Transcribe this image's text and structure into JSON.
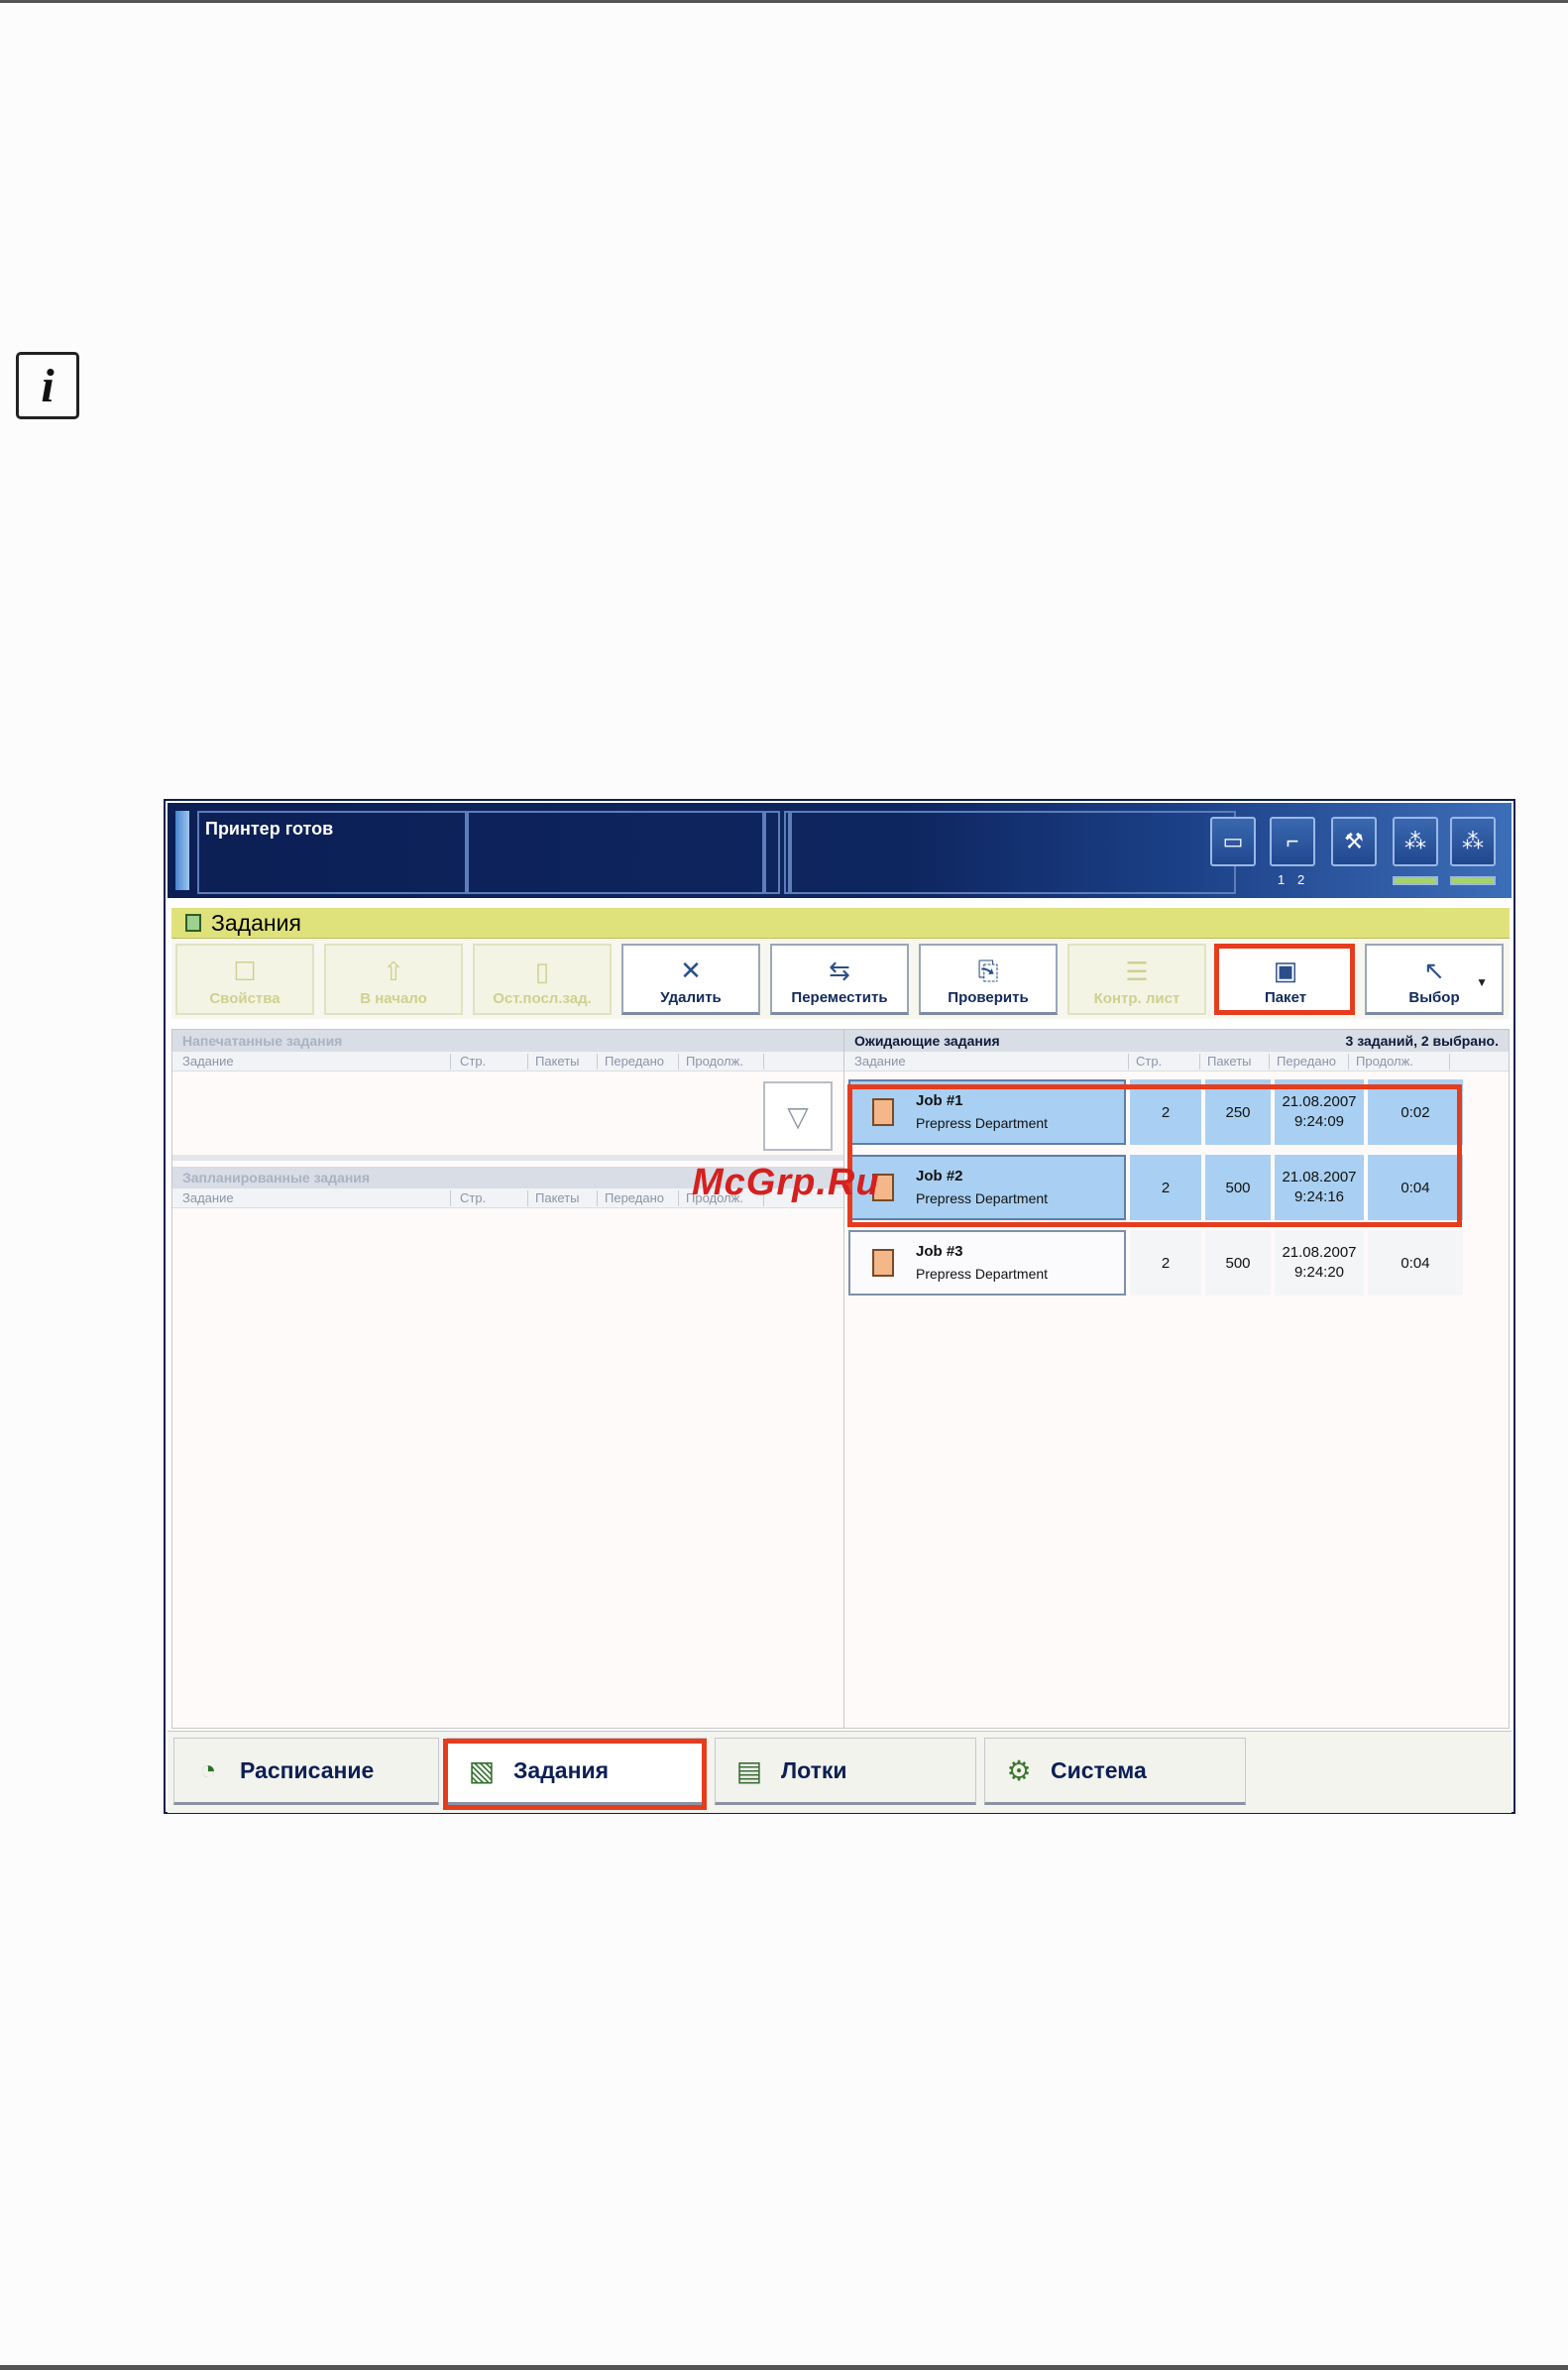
{
  "info_icon": {
    "glyph": "i"
  },
  "app": {
    "status": "Принтер готов",
    "header_numbers": [
      "1",
      "2"
    ],
    "title": "Задания",
    "toolbar": [
      {
        "label": "Свойства",
        "icon": "properties-icon",
        "glyph": "☐",
        "enabled": false
      },
      {
        "label": "В начало",
        "icon": "to-top-icon",
        "glyph": "⇧",
        "enabled": false
      },
      {
        "label": "Ост.посл.зад.",
        "icon": "stop-after-job-icon",
        "glyph": "▯",
        "enabled": false
      },
      {
        "label": "Удалить",
        "icon": "delete-icon",
        "glyph": "✕",
        "enabled": true
      },
      {
        "label": "Переместить",
        "icon": "move-icon",
        "glyph": "⇆",
        "enabled": true
      },
      {
        "label": "Проверить",
        "icon": "proof-icon",
        "glyph": "⎘",
        "enabled": true
      },
      {
        "label": "Контр. лист",
        "icon": "control-sheet-icon",
        "glyph": "☰",
        "enabled": false
      },
      {
        "label": "Пакет",
        "icon": "package-icon",
        "glyph": "▣",
        "enabled": true
      },
      {
        "label": "Выбор",
        "icon": "select-icon",
        "glyph": "↖",
        "enabled": true
      }
    ],
    "printed_jobs": {
      "title": "Напечатанные задания",
      "columns": [
        "Задание",
        "Стр.",
        "Пакеты",
        "Передано",
        "Продолж."
      ]
    },
    "scheduled_jobs": {
      "title": "Запланированные задания",
      "columns": [
        "Задание",
        "Стр.",
        "Пакеты",
        "Передано",
        "Продолж."
      ]
    },
    "waiting_jobs": {
      "title": "Ожидающие задания",
      "summary": "3 заданий, 2 выбрано.",
      "columns": [
        "Задание",
        "Стр.",
        "Пакеты",
        "Передано",
        "Продолж."
      ],
      "rows": [
        {
          "name": "Job #1",
          "dept": "Prepress Department",
          "pages": "2",
          "sets": "250",
          "date": "21.08.2007",
          "time": "9:24:09",
          "duration": "0:02",
          "selected": true
        },
        {
          "name": "Job #2",
          "dept": "Prepress Department",
          "pages": "2",
          "sets": "500",
          "date": "21.08.2007",
          "time": "9:24:16",
          "duration": "0:04",
          "selected": true
        },
        {
          "name": "Job #3",
          "dept": "Prepress Department",
          "pages": "2",
          "sets": "500",
          "date": "21.08.2007",
          "time": "9:24:20",
          "duration": "0:04",
          "selected": false
        }
      ]
    },
    "bottom_tabs": [
      {
        "label": "Расписание",
        "icon": "schedule-icon",
        "glyph": "◔"
      },
      {
        "label": "Задания",
        "icon": "jobs-icon",
        "glyph": "▧"
      },
      {
        "label": "Лотки",
        "icon": "trays-icon",
        "glyph": "▤"
      },
      {
        "label": "Система",
        "icon": "system-icon",
        "glyph": "⚙"
      }
    ],
    "colors": {
      "highlight": "#e63c1e",
      "selected_row": "#a9d0f2",
      "title_bar": "#dfe27a"
    }
  },
  "watermark": "McGrp.Ru"
}
